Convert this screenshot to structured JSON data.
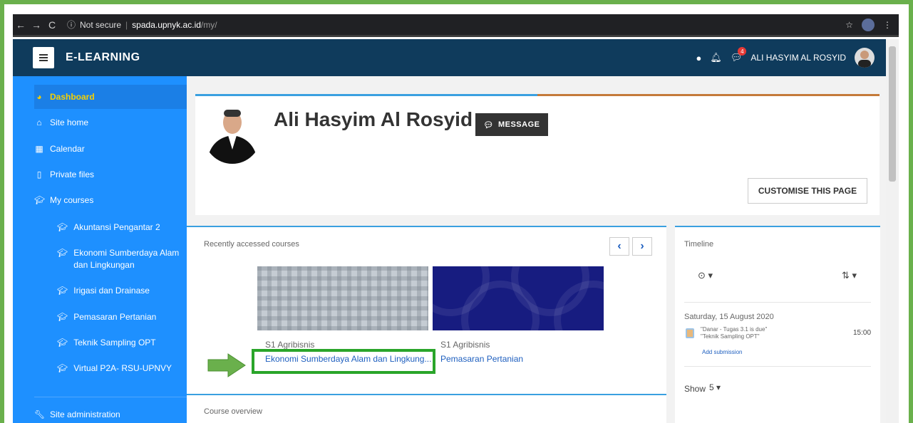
{
  "browser": {
    "back": "←",
    "forward": "→",
    "reload": "C",
    "security": "Not secure",
    "host": "spada.upnyk.ac.id",
    "path": "/my/"
  },
  "navbar": {
    "brand": "E-LEARNING",
    "user_name": "ALI HASYIM AL ROSYID",
    "message_badge": "4"
  },
  "sidebar": {
    "items": [
      {
        "label": "Dashboard",
        "icon": "dashboard-icon"
      },
      {
        "label": "Site home",
        "icon": "home-icon"
      },
      {
        "label": "Calendar",
        "icon": "calendar-icon"
      },
      {
        "label": "Private files",
        "icon": "file-icon"
      },
      {
        "label": "My courses",
        "icon": "graduation-cap-icon"
      }
    ],
    "courses": [
      "Akuntansi Pengantar 2",
      "Ekonomi Sumberdaya Alam dan Lingkungan",
      "Irigasi dan Drainase",
      "Pemasaran Pertanian",
      "Teknik Sampling OPT",
      "Virtual P2A- RSU-UPNVY"
    ],
    "admin": "Site administration"
  },
  "profile": {
    "name": "Ali Hasyim Al Rosyid",
    "message_button": "MESSAGE",
    "customise_button": "CUSTOMISE THIS PAGE"
  },
  "recent": {
    "title": "Recently accessed courses",
    "prev": "‹",
    "next": "›",
    "courses": [
      {
        "category": "S1 Agribisnis",
        "name": "Ekonomi Sumberdaya Alam dan Lingkung..."
      },
      {
        "category": "S1 Agribisnis",
        "name": "Pemasaran Pertanian"
      }
    ]
  },
  "overview": {
    "title": "Course overview"
  },
  "timeline": {
    "title": "Timeline",
    "date": "Saturday, 15 August 2020",
    "event_line1": "\"Danar - Tugas 3.1 is due\"",
    "event_line2": "\"Teknik Sampling OPT\"",
    "event_time": "15:00",
    "add_submission": "Add submission",
    "show_label": "Show",
    "show_value": "5"
  },
  "colors": {
    "frame": "#6ab04c",
    "navbar": "#0f3b5c",
    "sidebar": "#1e90ff",
    "active_label": "#f5d000",
    "highlight": "#2aa52a"
  }
}
